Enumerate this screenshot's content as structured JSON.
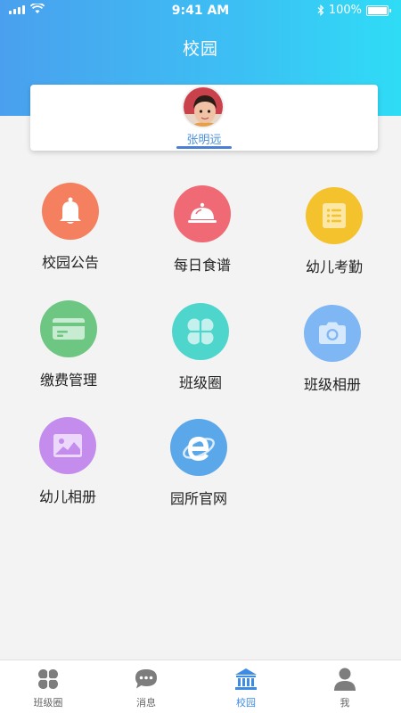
{
  "status_bar": {
    "time": "9:41 AM",
    "battery": "100%"
  },
  "header": {
    "title": "校园"
  },
  "profile": {
    "name": "张明远"
  },
  "grid": [
    {
      "label": "校园公告",
      "icon": "bell-icon",
      "color": "#f4805f"
    },
    {
      "label": "每日食谱",
      "icon": "food-cloche-icon",
      "color": "#ef6a74"
    },
    {
      "label": "幼儿考勤",
      "icon": "notes-icon",
      "color": "#f4c22c"
    },
    {
      "label": "缴费管理",
      "icon": "card-icon",
      "color": "#6dc783"
    },
    {
      "label": "班级圈",
      "icon": "clover-icon",
      "color": "#4fd6cc"
    },
    {
      "label": "班级相册",
      "icon": "camera-icon",
      "color": "#7fb6f4"
    },
    {
      "label": "幼儿相册",
      "icon": "picture-icon",
      "color": "#c48cec"
    },
    {
      "label": "园所官网",
      "icon": "browser-e-icon",
      "color": "#5aa7ea"
    }
  ],
  "tabbar": {
    "items": [
      {
        "label": "班级圈",
        "icon": "clover-icon",
        "active": false
      },
      {
        "label": "消息",
        "icon": "chat-bubble-icon",
        "active": false
      },
      {
        "label": "校园",
        "icon": "school-building-icon",
        "active": true
      },
      {
        "label": "我",
        "icon": "person-icon",
        "active": false
      }
    ]
  },
  "colors": {
    "header_gradient_start": "#4aa0ee",
    "header_gradient_end": "#2fdcf6",
    "active_tab": "#3c8ce7",
    "content_bg": "#f3f3f3"
  }
}
